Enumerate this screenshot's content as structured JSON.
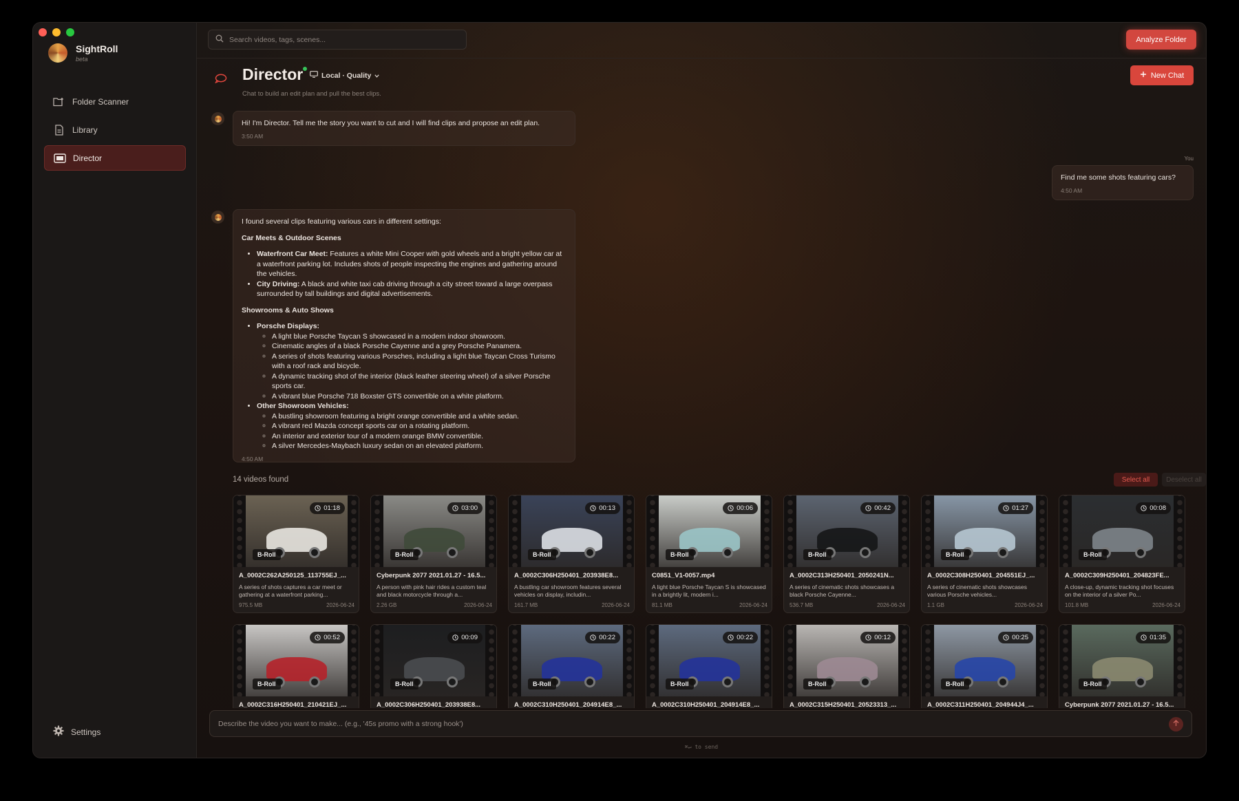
{
  "app": {
    "name": "SightRoll",
    "tag": "beta"
  },
  "window_controls": {
    "close": "#ff5f57",
    "minimize": "#febc2e",
    "zoom": "#28c840"
  },
  "sidebar": {
    "items": [
      {
        "label": "Folder Scanner",
        "icon": "folder-scan-icon",
        "active": false
      },
      {
        "label": "Library",
        "icon": "document-icon",
        "active": false
      },
      {
        "label": "Director",
        "icon": "film-icon",
        "active": true
      }
    ],
    "settings_label": "Settings"
  },
  "topbar": {
    "search_placeholder": "Search videos, tags, scenes...",
    "analyze_label": "Analyze Folder"
  },
  "header": {
    "title": "Director",
    "model_label": "Local · Quality",
    "subtitle": "Chat to build an edit plan and pull the best clips.",
    "new_chat_label": "New Chat"
  },
  "chat": {
    "greeting": {
      "text": "Hi! I'm Director. Tell me the story you want to cut and I will find clips and propose an edit plan.",
      "time": "3:50 AM"
    },
    "user": {
      "label": "You",
      "text": "Find me some shots featuring cars?",
      "time": "4:50 AM"
    },
    "reply": {
      "intro": "I found several clips featuring various cars in different settings:",
      "section1": "Car Meets & Outdoor Scenes",
      "item1_bold": "Waterfront Car Meet:",
      "item1_text": " Features a white Mini Cooper with gold wheels and a bright yellow car at a waterfront parking lot. Includes shots of people inspecting the engines and gathering around the vehicles.",
      "item2_bold": "City Driving:",
      "item2_text": " A black and white taxi cab driving through a city street toward a large overpass surrounded by tall buildings and digital advertisements.",
      "section2": "Showrooms & Auto Shows",
      "item3_bold": "Porsche Displays:",
      "item3_subs": [
        "A light blue Porsche Taycan S showcased in a modern indoor showroom.",
        "Cinematic angles of a black Porsche Cayenne and a grey Porsche Panamera.",
        "A series of shots featuring various Porsches, including a light blue Taycan Cross Turismo with a roof rack and bicycle.",
        "A dynamic tracking shot of the interior (black leather steering wheel) of a silver Porsche sports car.",
        "A vibrant blue Porsche 718 Boxster GTS convertible on a white platform."
      ],
      "item4_bold": "Other Showroom Vehicles:",
      "item4_subs": [
        "A bustling showroom featuring a bright orange convertible and a white sedan.",
        "A vibrant red Mazda concept sports car on a rotating platform.",
        "An interior and exterior tour of a modern orange BMW convertible.",
        "A silver Mercedes-Maybach luxury sedan on an elevated platform."
      ],
      "time": "4:50 AM"
    }
  },
  "results": {
    "count_label": "14 videos found",
    "select_all_label": "Select all",
    "deselect_label": "Deselect all",
    "videos": [
      {
        "duration": "01:18",
        "tag": "B-Roll",
        "name": "A_0002C262A250125_113755EJ_...",
        "desc": "A series of shots captures a car meet or gathering at a waterfront parking...",
        "size": "975.5 MB",
        "date": "2026-06-24",
        "bg": "#6b6253",
        "car": "#e8e6e0"
      },
      {
        "duration": "03:00",
        "tag": "B-Roll",
        "name": "Cyberpunk 2077 2021.01.27 - 16.5...",
        "desc": "A person with pink hair rides a custom teal and black motorcycle through a...",
        "size": "2.26 GB",
        "date": "2026-06-24",
        "bg": "#8a8a86",
        "car": "#3f4a3a"
      },
      {
        "duration": "00:13",
        "tag": "B-Roll",
        "name": "A_0002C306H250401_203938E8...",
        "desc": "A bustling car showroom features several vehicles on display, includin...",
        "size": "161.7 MB",
        "date": "2026-06-24",
        "bg": "#3a4358",
        "car": "#dcdfe4"
      },
      {
        "duration": "00:06",
        "tag": "B-Roll",
        "name": "C0851_V1-0057.mp4",
        "desc": "A light blue Porsche Taycan S is showcased in a brightly lit, modern i...",
        "size": "81.1 MB",
        "date": "2026-06-24",
        "bg": "#c9ccc8",
        "car": "#9ac4c6"
      },
      {
        "duration": "00:42",
        "tag": "B-Roll",
        "name": "A_0002C313H250401_2050241N...",
        "desc": "A series of cinematic shots showcases a black Porsche Cayenne...",
        "size": "536.7 MB",
        "date": "2026-06-24",
        "bg": "#5c6470",
        "car": "#151617"
      },
      {
        "duration": "01:27",
        "tag": "B-Roll",
        "name": "A_0002C308H250401_204551EJ_...",
        "desc": "A series of cinematic shots showcases various Porsche vehicles...",
        "size": "1.1 GB",
        "date": "2026-06-24",
        "bg": "#8796a6",
        "car": "#b6c6d1"
      },
      {
        "duration": "00:08",
        "tag": "B-Roll",
        "name": "A_0002C309H250401_204823FE...",
        "desc": "A close-up, dynamic tracking shot focuses on the interior of a silver Po...",
        "size": "101.8 MB",
        "date": "2026-06-24",
        "bg": "#2b2e31",
        "car": "#7d848a"
      },
      {
        "duration": "00:52",
        "tag": "B-Roll",
        "name": "A_0002C316H250401_210421EJ_...",
        "desc": "",
        "size": "",
        "date": "",
        "bg": "#c8c6c4",
        "car": "#b5222a"
      },
      {
        "duration": "00:09",
        "tag": "B-Roll",
        "name": "A_0002C306H250401_203938E8...",
        "desc": "",
        "size": "",
        "date": "",
        "bg": "#1d1e20",
        "car": "#4a4c50"
      },
      {
        "duration": "00:22",
        "tag": "B-Roll",
        "name": "A_0002C310H250401_204914E8_...",
        "desc": "",
        "size": "",
        "date": "",
        "bg": "#5d6a7e",
        "car": "#23339a"
      },
      {
        "duration": "00:22",
        "tag": "B-Roll",
        "name": "A_0002C310H250401_204914E8_...",
        "desc": "",
        "size": "",
        "date": "",
        "bg": "#5d6a7e",
        "car": "#23339a"
      },
      {
        "duration": "00:12",
        "tag": "B-Roll",
        "name": "A_0002C315H250401_20523313_...",
        "desc": "",
        "size": "",
        "date": "",
        "bg": "#b9b6b3",
        "car": "#9d8a93"
      },
      {
        "duration": "00:25",
        "tag": "B-Roll",
        "name": "A_0002C311H250401_204944J4_...",
        "desc": "",
        "size": "",
        "date": "",
        "bg": "#8e98a4",
        "car": "#2746a8"
      },
      {
        "duration": "01:35",
        "tag": "B-Roll",
        "name": "Cyberpunk 2077 2021.01.27 - 16.5...",
        "desc": "",
        "size": "",
        "date": "",
        "bg": "#5a6a5e",
        "car": "#8b8a70"
      }
    ]
  },
  "composer": {
    "placeholder": "Describe the video you want to make... (e.g., '45s promo with a strong hook')",
    "hint": "⌘↵ to send"
  }
}
